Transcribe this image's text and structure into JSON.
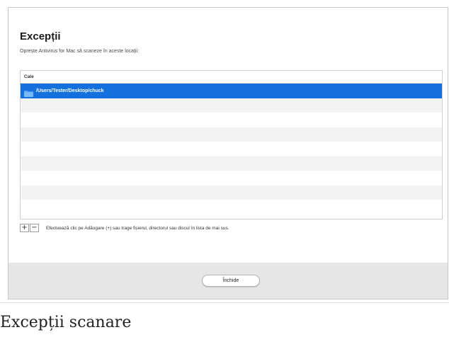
{
  "dialog": {
    "title": "Excepții",
    "subtitle": "Oprește Antivirus for Mac să scaneze în aceste locații:",
    "table": {
      "column_header": "Cale",
      "rows": [
        {
          "path": "/Users/Tester/Desktop/chuck",
          "icon": "folder-icon",
          "selected": true
        }
      ],
      "empty_row_count": 8
    },
    "controls": {
      "add_label": "+",
      "remove_label": "−",
      "hint": "Efectuează clic pe Adăugare (+) sau trage fișierul, directorul sau discul în lista de mai sus."
    },
    "footer": {
      "close_label": "Închide"
    }
  },
  "caption": "Excepții scanare",
  "colors": {
    "selection": "#1470dc",
    "folder": "#5aa7f3",
    "footer_bg": "#e6e6e6"
  }
}
